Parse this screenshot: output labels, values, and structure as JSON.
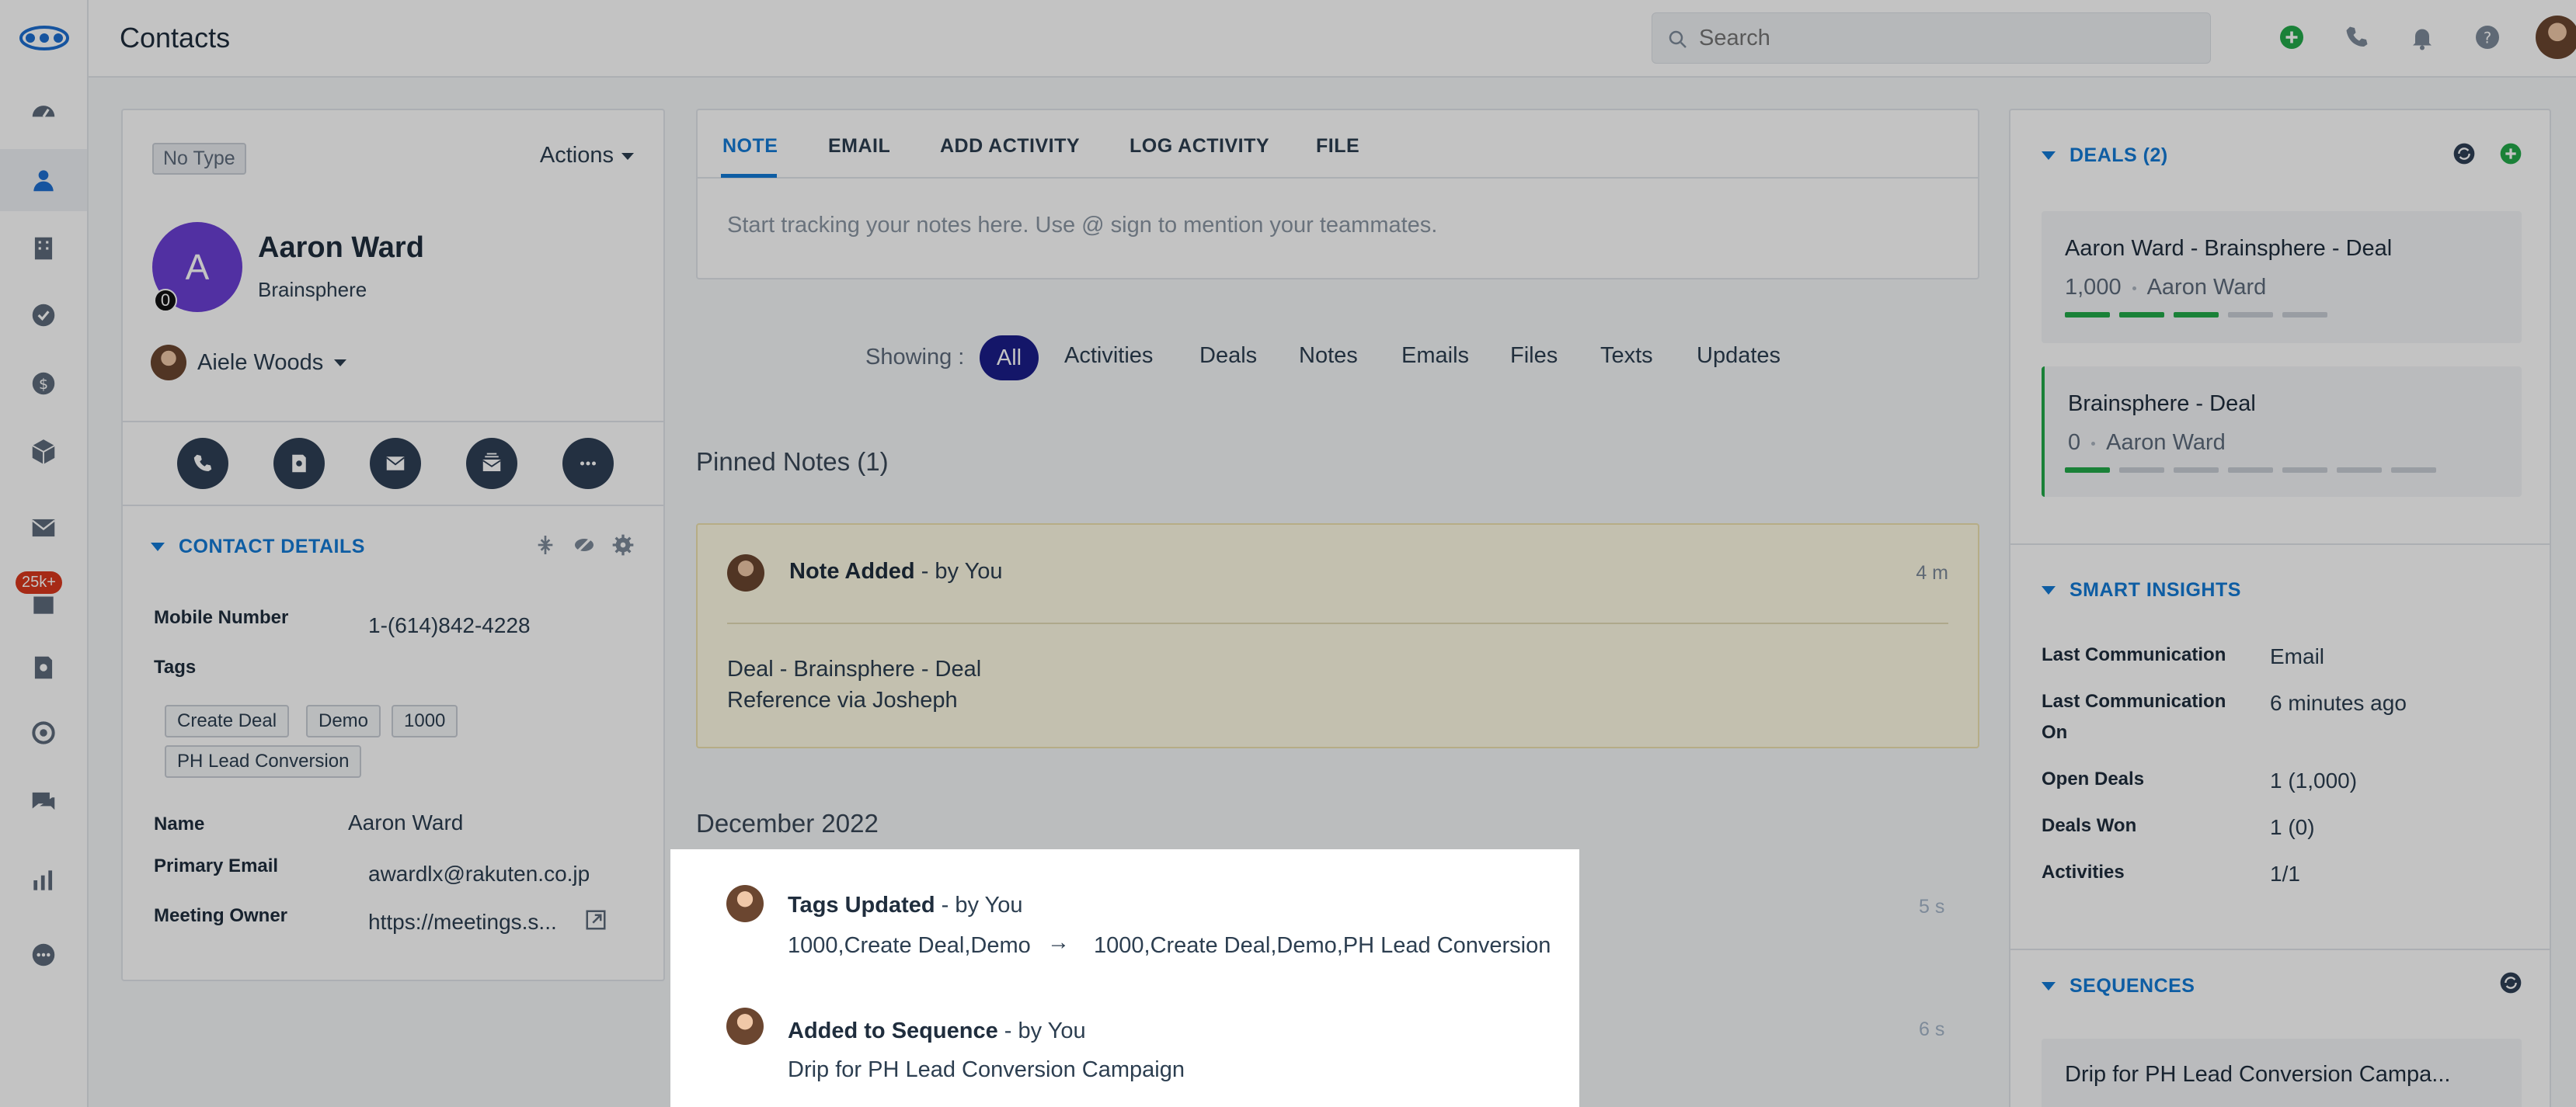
{
  "header": {
    "title": "Contacts",
    "search_placeholder": "Search"
  },
  "nav": {
    "badge": "25k+"
  },
  "contact": {
    "type": "No Type",
    "actions_label": "Actions",
    "initial": "A",
    "avatar_count": "0",
    "name": "Aaron Ward",
    "company": "Brainsphere",
    "owner": "Aiele Woods"
  },
  "contact_details": {
    "heading": "CONTACT DETAILS",
    "mobile_label": "Mobile Number",
    "mobile_value": "1-(614)842-4228",
    "tags_label": "Tags",
    "tags": [
      "Create Deal",
      "Demo",
      "1000",
      "PH Lead Conversion"
    ],
    "name_label": "Name",
    "name_value": "Aaron Ward",
    "email_label": "Primary Email",
    "email_value": "awardlx@rakuten.co.jp",
    "meeting_label": "Meeting Owner",
    "meeting_value": "https://meetings.s..."
  },
  "composer": {
    "tabs": [
      "NOTE",
      "EMAIL",
      "ADD ACTIVITY",
      "LOG ACTIVITY",
      "FILE"
    ],
    "placeholder": "Start tracking your notes here. Use @ sign to mention your teammates."
  },
  "filters": {
    "showing_label": "Showing :",
    "items": [
      "All",
      "Activities",
      "Deals",
      "Notes",
      "Emails",
      "Files",
      "Texts",
      "Updates"
    ]
  },
  "pinned": {
    "heading": "Pinned Notes (1)",
    "title": "Note Added",
    "by": " - by You",
    "time": "4 m",
    "line1": "Deal - Brainsphere - Deal",
    "line2": "Reference via Josheph"
  },
  "timeline": {
    "month": "December 2022",
    "items": [
      {
        "title": "Tags Updated",
        "by": " - by You",
        "from": "1000,Create Deal,Demo",
        "arrow": "→",
        "to": "1000,Create Deal,Demo,PH Lead Conversion",
        "time": "5 s"
      },
      {
        "title": "Added to Sequence",
        "by": " - by You",
        "detail": "Drip for PH Lead Conversion Campaign",
        "time": "6 s"
      }
    ]
  },
  "deals": {
    "heading": "DEALS (2)",
    "items": [
      {
        "name": "Aaron Ward - Brainsphere - Deal",
        "amount": "1,000",
        "owner": "Aaron Ward",
        "stages_total": 5,
        "stages_done": 3
      },
      {
        "name": "Brainsphere - Deal",
        "amount": "0",
        "owner": "Aaron Ward",
        "stages_total": 7,
        "stages_done": 1
      }
    ]
  },
  "insights": {
    "heading": "SMART INSIGHTS",
    "rows": [
      {
        "label": "Last Communication",
        "value": "Email"
      },
      {
        "label": "Last Communication On",
        "value": "6 minutes ago"
      },
      {
        "label": "Open Deals",
        "value": "1 (1,000)"
      },
      {
        "label": "Deals Won",
        "value": "1 (0)"
      },
      {
        "label": "Activities",
        "value": "1/1"
      }
    ]
  },
  "sequences": {
    "heading": "SEQUENCES",
    "item": "Drip for PH Lead Conversion Campa..."
  },
  "colors": {
    "accent": "#137ad6",
    "stage_done": "#22a94a",
    "stage_todo": "#c9ced6",
    "filter_active": "#1b1e8a",
    "avatar": "#6b3fd4"
  }
}
